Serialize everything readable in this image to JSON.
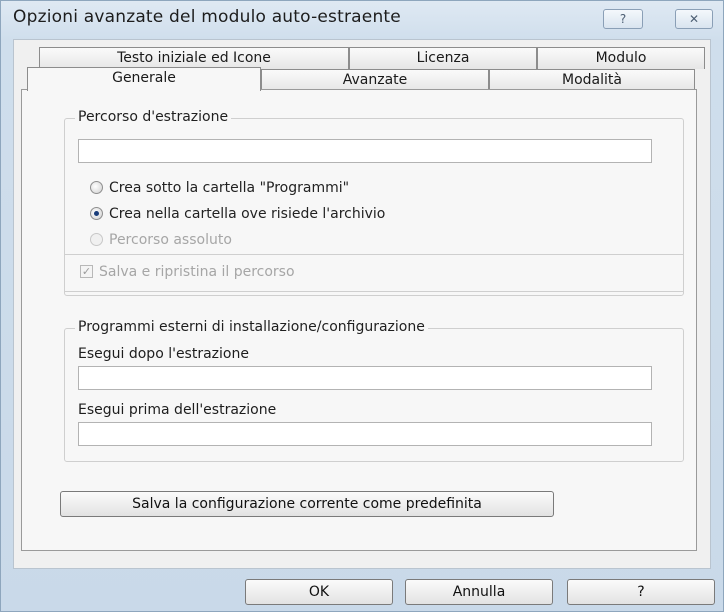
{
  "window": {
    "title": "Opzioni avanzate del modulo auto-estraente",
    "help_glyph": "?",
    "close_glyph": "✕"
  },
  "tabs_row1": [
    "Testo iniziale ed Icone",
    "Licenza",
    "Modulo"
  ],
  "tabs_row2": [
    "Generale",
    "Avanzate",
    "Modalità"
  ],
  "active_tab": "Generale",
  "extraction_path": {
    "group_label": "Percorso d'estrazione",
    "path_value": "",
    "options": [
      {
        "label": "Crea sotto la cartella \"Programmi\"",
        "checked": false,
        "enabled": true
      },
      {
        "label": "Crea nella cartella ove risiede l'archivio",
        "checked": true,
        "enabled": true
      },
      {
        "label": "Percorso assoluto",
        "checked": false,
        "enabled": false
      }
    ],
    "save_restore_label": "Salva e ripristina il percorso",
    "save_restore_checked": true,
    "save_restore_enabled": false
  },
  "external_programs": {
    "group_label": "Programmi esterni di installazione/configurazione",
    "after_label": "Esegui dopo l'estrazione",
    "after_value": "",
    "before_label": "Esegui prima dell'estrazione",
    "before_value": ""
  },
  "save_default_label": "Salva la configurazione corrente come predefinita",
  "footer": {
    "ok_label": "OK",
    "cancel_label": "Annulla",
    "help_label": "?"
  }
}
